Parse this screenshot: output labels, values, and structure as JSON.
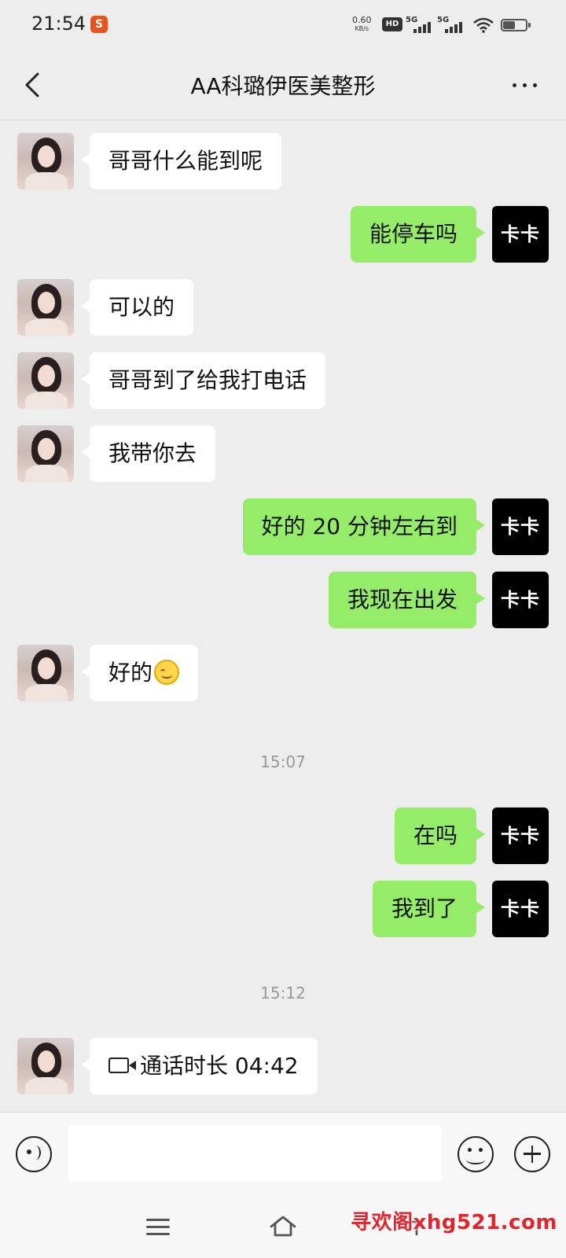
{
  "status_bar": {
    "time": "21:54",
    "app_icon": "S",
    "net_speed": "0.60",
    "net_unit": "KB/s",
    "hd": "HD",
    "signal1": "5G",
    "signal2": "5G"
  },
  "header": {
    "title": "AA科璐伊医美整形"
  },
  "messages": [
    {
      "side": "in",
      "text": "哥哥什么能到呢"
    },
    {
      "side": "out",
      "text": "能停车吗"
    },
    {
      "side": "in",
      "text": "可以的"
    },
    {
      "side": "in",
      "text": "哥哥到了给我打电话"
    },
    {
      "side": "in",
      "text": "我带你去"
    },
    {
      "side": "out",
      "text": "好的 20 分钟左右到"
    },
    {
      "side": "out",
      "text": "我现在出发"
    },
    {
      "side": "in",
      "text": "好的"
    },
    {
      "side": "out",
      "text": "在吗"
    },
    {
      "side": "out",
      "text": "我到了"
    },
    {
      "side": "in",
      "text": "通话时长 04:42"
    }
  ],
  "timestamps": [
    "15:07",
    "15:12"
  ],
  "self_avatar_label": "卡卡",
  "watermark": "寻欢阁xhg521.com",
  "icons": {
    "back": "chevron-left-icon",
    "more": "more-icon",
    "voice": "voice-icon",
    "emoji": "emoji-icon",
    "plus": "plus-icon",
    "video_call": "video-call-icon",
    "smile_emoji": "smile-emoji-icon"
  },
  "colors": {
    "background": "#ededed",
    "outgoing_bubble": "#95ec69",
    "incoming_bubble": "#ffffff",
    "watermark": "#e8222a"
  }
}
